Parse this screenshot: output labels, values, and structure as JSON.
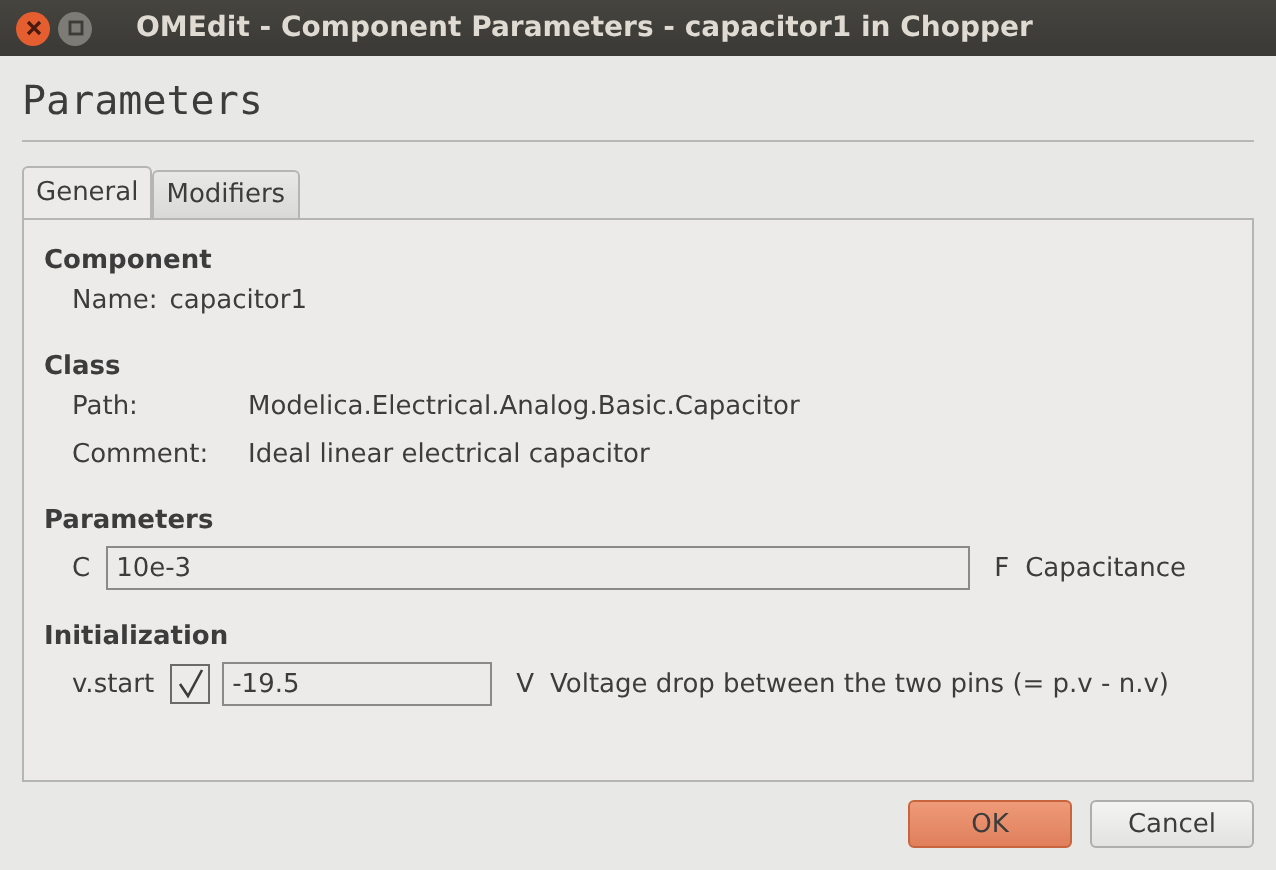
{
  "window": {
    "title": "OMEdit - Component Parameters - capacitor1 in Chopper"
  },
  "heading": "Parameters",
  "tabs": [
    {
      "label": "General",
      "selected": true
    },
    {
      "label": "Modifiers",
      "selected": false
    }
  ],
  "component": {
    "heading": "Component",
    "name_label": "Name:",
    "name_value": "capacitor1"
  },
  "class": {
    "heading": "Class",
    "rows": [
      {
        "label": "Path:",
        "value": "Modelica.Electrical.Analog.Basic.Capacitor"
      },
      {
        "label": "Comment:",
        "value": "Ideal linear electrical capacitor"
      }
    ]
  },
  "parameters": {
    "heading": "Parameters",
    "rows": [
      {
        "name": "C",
        "value": "10e-3",
        "unit": "F",
        "description": "Capacitance"
      }
    ]
  },
  "initialization": {
    "heading": "Initialization",
    "rows": [
      {
        "name": "v.start",
        "checked": true,
        "value": "-19.5",
        "unit": "V",
        "description": "Voltage drop between the two pins (= p.v - n.v)"
      }
    ]
  },
  "buttons": [
    {
      "label": "OK",
      "kind": "primary"
    },
    {
      "label": "Cancel",
      "kind": "secondary"
    }
  ]
}
